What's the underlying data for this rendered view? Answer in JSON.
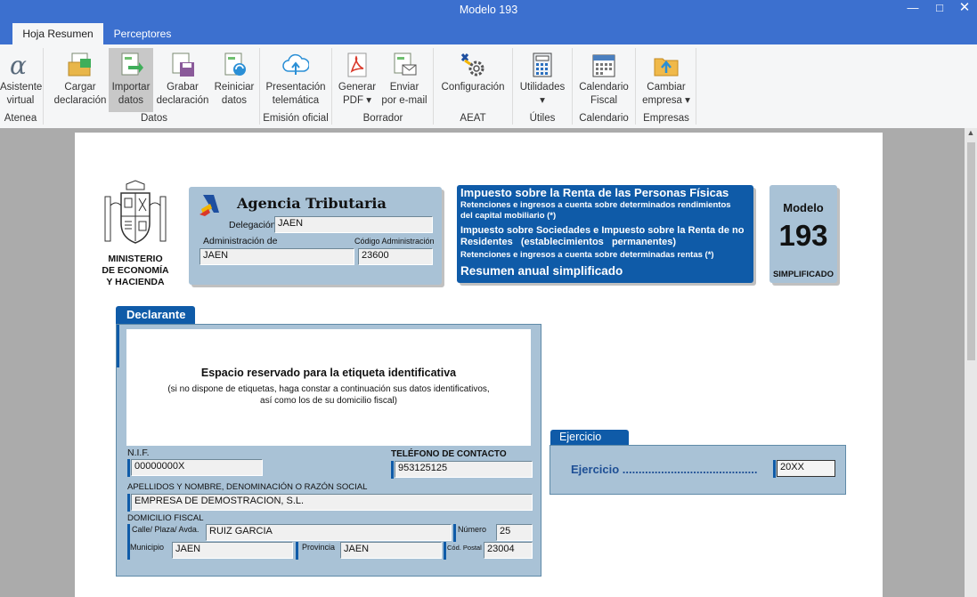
{
  "window": {
    "title": "Modelo 193"
  },
  "tabs": [
    {
      "label": "Hoja Resumen",
      "active": true
    },
    {
      "label": "Perceptores",
      "active": false
    }
  ],
  "ribbon": {
    "groups": [
      {
        "label": "Atenea"
      },
      {
        "label": "Datos"
      },
      {
        "label": "Emisión oficial"
      },
      {
        "label": "Borrador"
      },
      {
        "label": "AEAT"
      },
      {
        "label": "Útiles"
      },
      {
        "label": "Calendario"
      },
      {
        "label": "Empresas"
      }
    ],
    "buttons": {
      "asistente": {
        "l1": "Asistente",
        "l2": "virtual"
      },
      "cargar": {
        "l1": "Cargar",
        "l2": "declaración"
      },
      "importar": {
        "l1": "Importar",
        "l2": "datos"
      },
      "grabar": {
        "l1": "Grabar",
        "l2": "declaración"
      },
      "reiniciar": {
        "l1": "Reiniciar",
        "l2": "datos"
      },
      "presentacion": {
        "l1": "Presentación",
        "l2": "telemática"
      },
      "generar": {
        "l1": "Generar",
        "l2": "PDF ▾"
      },
      "enviar": {
        "l1": "Enviar",
        "l2": "por e-mail"
      },
      "configuracion": {
        "l1": "Configuración",
        "l2": ""
      },
      "utilidades": {
        "l1": "Utilidades",
        "l2": "▾"
      },
      "calendario": {
        "l1": "Calendario",
        "l2": "Fiscal"
      },
      "cambiar": {
        "l1": "Cambiar",
        "l2": "empresa ▾"
      }
    }
  },
  "form": {
    "ministerio": {
      "l1": "MINISTERIO",
      "l2": "DE ECONOMÍA",
      "l3": "Y HACIENDA"
    },
    "agencia": {
      "title": "Agencia Tributaria",
      "delegacion_label": "Delegación de",
      "delegacion_value": "JAEN",
      "administracion_label": "Administración de",
      "administracion_value": "JAEN",
      "codigo_label": "Código Administración",
      "codigo_value": "23600"
    },
    "impuesto": {
      "h1": "Impuesto sobre la Renta de las Personas Físicas",
      "t1a": "Retenciones e ingresos a cuenta sobre determinados rendimientos",
      "t1b": "del capital mobiliario (*)",
      "h2a": "Impuesto sobre Sociedades e Impuesto sobre la Renta de no",
      "h2b": "Residentes   (establecimientos   permanentes)",
      "t2": "Retenciones e ingresos a cuenta sobre determinadas rentas (*)",
      "h3": "Resumen anual simplificado"
    },
    "modelo": {
      "label": "Modelo",
      "number": "193",
      "sub": "SIMPLIFICADO"
    },
    "declarante": {
      "tab": "Declarante",
      "etiqueta_title": "Espacio reservado para la etiqueta identificativa",
      "etiqueta_sub1": "(si no dispone de etiquetas, haga constar a continuación sus datos identificativos,",
      "etiqueta_sub2": "así como los de su domicilio fiscal)",
      "nif_label": "N.I.F.",
      "nif_value": "00000000X",
      "telefono_label": "TELÉFONO DE CONTACTO",
      "telefono_value": "953125125",
      "apellidos_label": "APELLIDOS Y NOMBRE, DENOMINACIÓN O RAZÓN SOCIAL",
      "apellidos_value": "EMPRESA DE DEMOSTRACION, S.L.",
      "domicilio_label": "DOMICILIO FISCAL",
      "calle_label": "Calle/ Plaza/ Avda.",
      "calle_value": "RUIZ GARCIA",
      "numero_label": "Número",
      "numero_value": "25",
      "municipio_label": "Municipio",
      "municipio_value": "JAEN",
      "provincia_label": "Provincia",
      "provincia_value": "JAEN",
      "cp_label": "Cód. Postal",
      "cp_value": "23004"
    },
    "ejercicio": {
      "tab": "Ejercicio",
      "label": "Ejercicio ..........................................",
      "value": "20XX"
    }
  }
}
